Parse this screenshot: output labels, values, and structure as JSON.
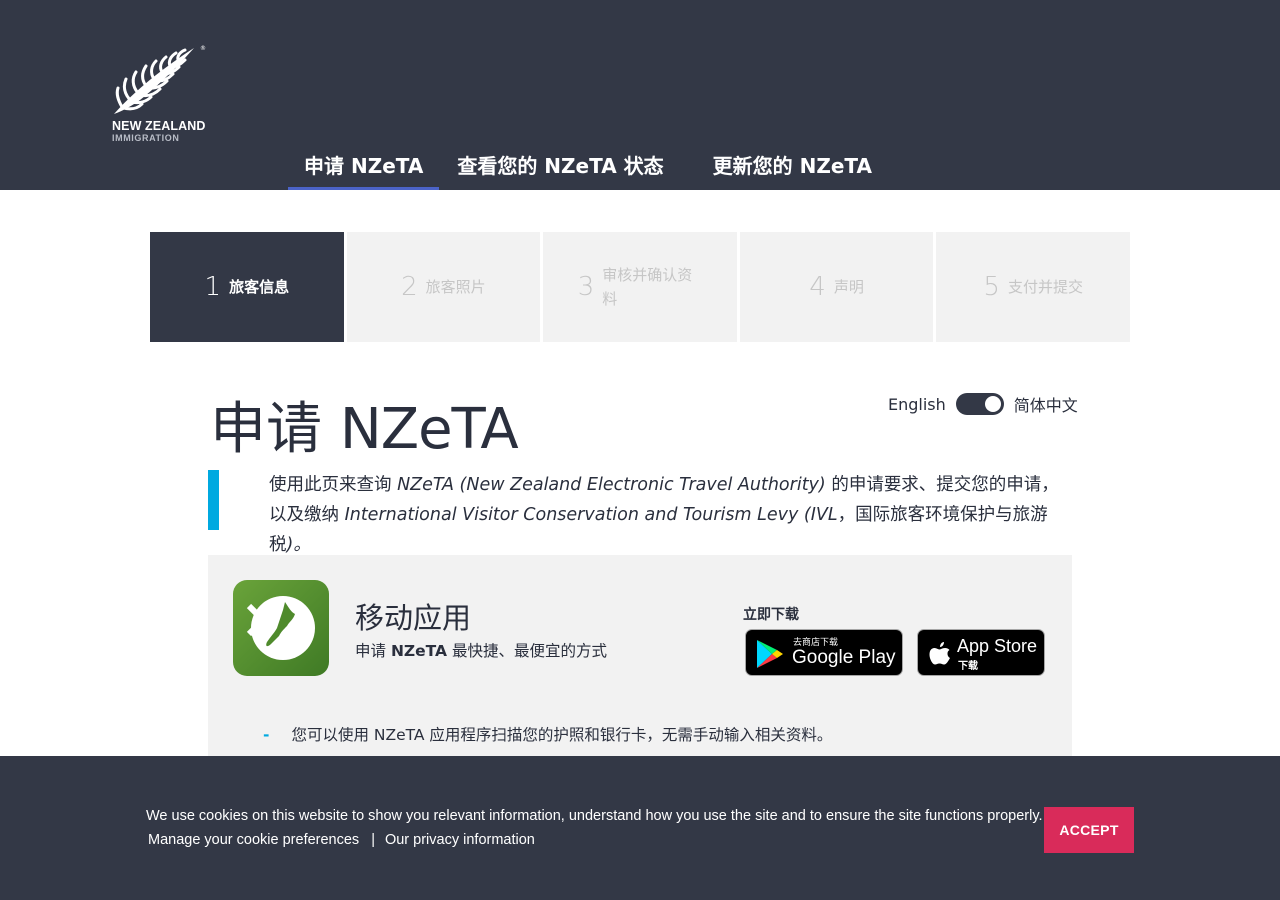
{
  "header": {
    "logo_text": "NEW ZEALAND",
    "logo_subtext": "IMMIGRATION",
    "logo_tm": "®",
    "nav": [
      {
        "label": "申请 NZeTA"
      },
      {
        "label": "查看您的 NZeTA 状态"
      },
      {
        "label": "更新您的 NZeTA"
      }
    ],
    "active_nav_index": 0
  },
  "steps": [
    {
      "number": "1",
      "label": "旅客信息",
      "active": true
    },
    {
      "number": "2",
      "label": "旅客照片",
      "active": false
    },
    {
      "number": "3",
      "label": "审核并确认资料",
      "active": false
    },
    {
      "number": "4",
      "label": "声明",
      "active": false
    },
    {
      "number": "5",
      "label": "支付并提交",
      "active": false
    }
  ],
  "page": {
    "title_cjk": "申请",
    "title_latin": "NZeTA",
    "language_toggle": {
      "left": "English",
      "right": "简体中文",
      "selected": "简体中文"
    },
    "intro": {
      "part1": "使用此页来查询 ",
      "italic1": "NZeTA (New Zealand Electronic Travel Authority)",
      "part2": " 的申请要求、提交您的申请，以及缴纳 ",
      "italic2": "International Visitor Conservation and Tourism Levy (IVL",
      "part3": "，国际旅客环境保护与旅游税",
      "part4": ")。"
    }
  },
  "app_panel": {
    "name": "移动应用",
    "tagline_prefix": "申请 ",
    "tagline_bold": "NZeTA",
    "tagline_suffix": " 最快捷、最便宜的方式",
    "download_label": "立即下载",
    "google_play": {
      "small": "去商店下载",
      "big": "Google Play"
    },
    "app_store": {
      "big": "App Store",
      "small": "下载"
    },
    "bullet": "您可以使用 NZeTA 应用程序扫描您的护照和银行卡，无需手动输入相关资料。"
  },
  "cookie_banner": {
    "text": "We use cookies on this website to show you relevant information, understand how you use the site and to ensure the site functions properly.",
    "manage_link": "Manage your cookie preferences",
    "separator": "|",
    "privacy_link": "Our privacy information",
    "accept_label": "ACCEPT"
  },
  "colors": {
    "header_bg": "#333846",
    "accent_blue": "#00a9e0",
    "nav_underline": "#4b63c8",
    "accept_button": "#d92b5a",
    "panel_bg": "#f2f2f2"
  }
}
